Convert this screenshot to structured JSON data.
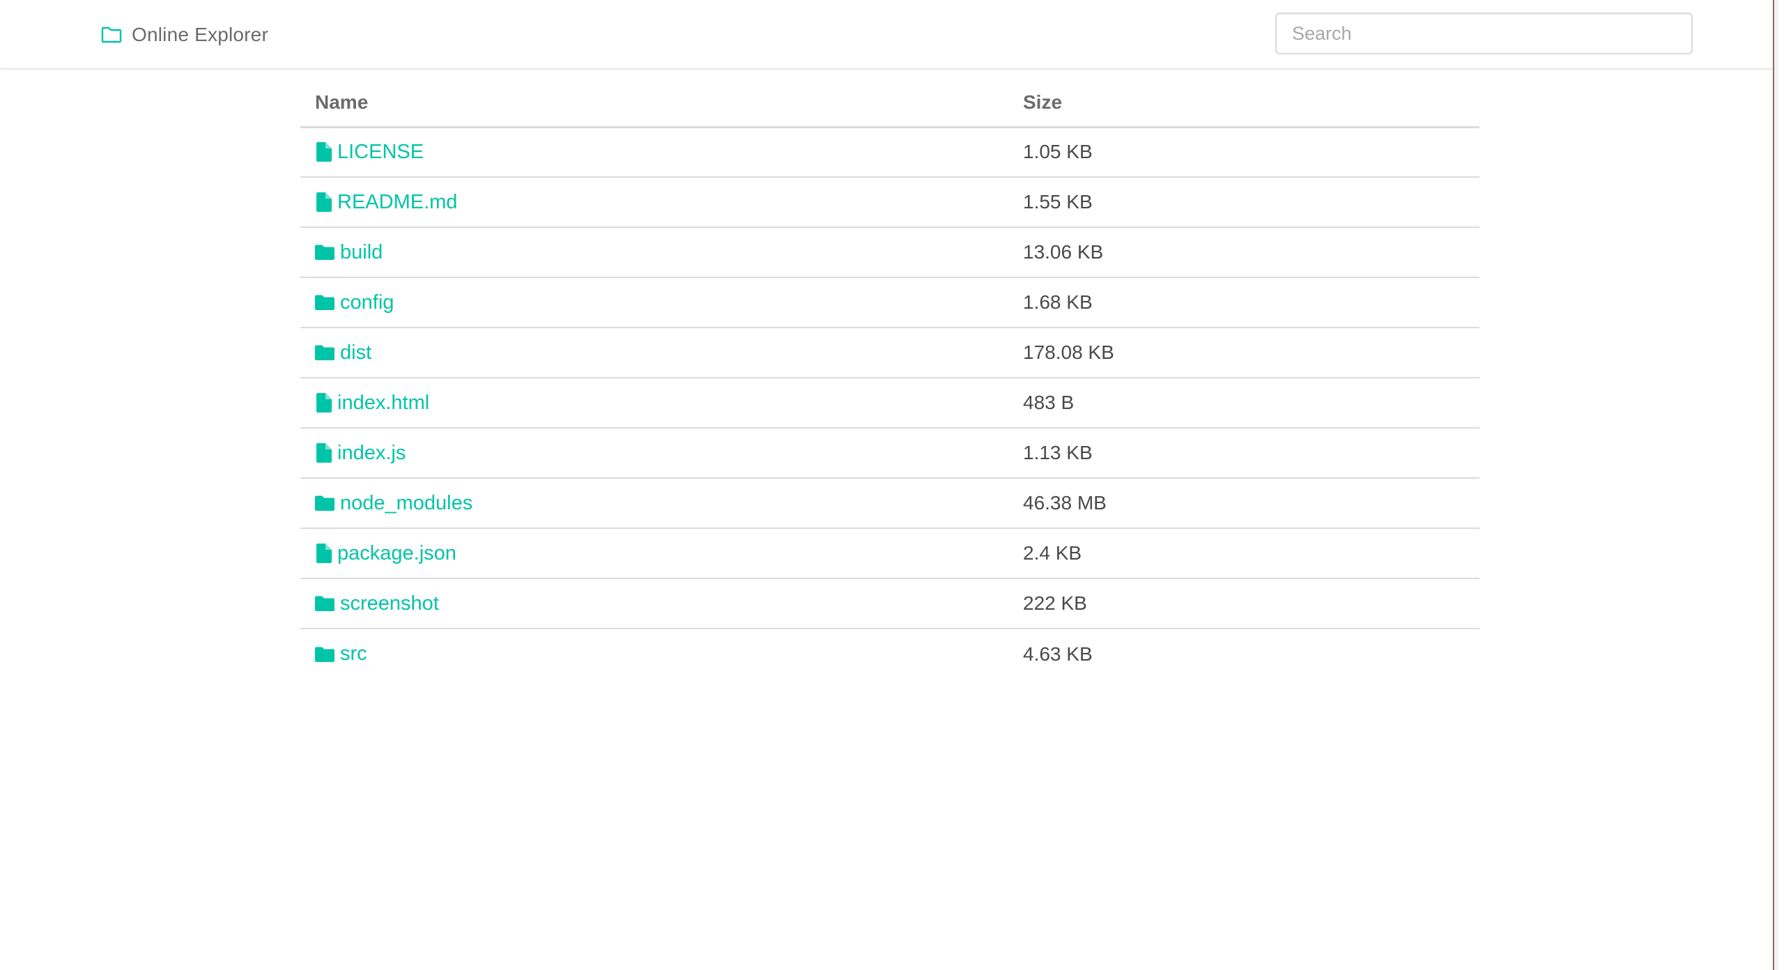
{
  "navbar": {
    "brand_icon": "folder-outline-icon",
    "brand_text": "Online Explorer",
    "search_placeholder": "Search",
    "search_value": ""
  },
  "colors": {
    "accent": "#00c4a7",
    "text": "#4a4a4a",
    "header_text": "#6b6b6b",
    "border": "#dbdbdb"
  },
  "table": {
    "headers": {
      "name": "Name",
      "size": "Size"
    },
    "rows": [
      {
        "name": "LICENSE",
        "size": "1.05 KB",
        "type": "file",
        "icon": "file-icon"
      },
      {
        "name": "README.md",
        "size": "1.55 KB",
        "type": "file",
        "icon": "file-icon"
      },
      {
        "name": "build",
        "size": "13.06 KB",
        "type": "folder",
        "icon": "folder-icon"
      },
      {
        "name": "config",
        "size": "1.68 KB",
        "type": "folder",
        "icon": "folder-icon"
      },
      {
        "name": "dist",
        "size": "178.08 KB",
        "type": "folder",
        "icon": "folder-icon"
      },
      {
        "name": "index.html",
        "size": "483 B",
        "type": "file",
        "icon": "file-icon"
      },
      {
        "name": "index.js",
        "size": "1.13 KB",
        "type": "file",
        "icon": "file-icon"
      },
      {
        "name": "node_modules",
        "size": "46.38 MB",
        "type": "folder",
        "icon": "folder-icon"
      },
      {
        "name": "package.json",
        "size": "2.4 KB",
        "type": "file",
        "icon": "file-icon"
      },
      {
        "name": "screenshot",
        "size": "222 KB",
        "type": "folder",
        "icon": "folder-icon"
      },
      {
        "name": "src",
        "size": "4.63 KB",
        "type": "folder",
        "icon": "folder-icon"
      }
    ]
  }
}
